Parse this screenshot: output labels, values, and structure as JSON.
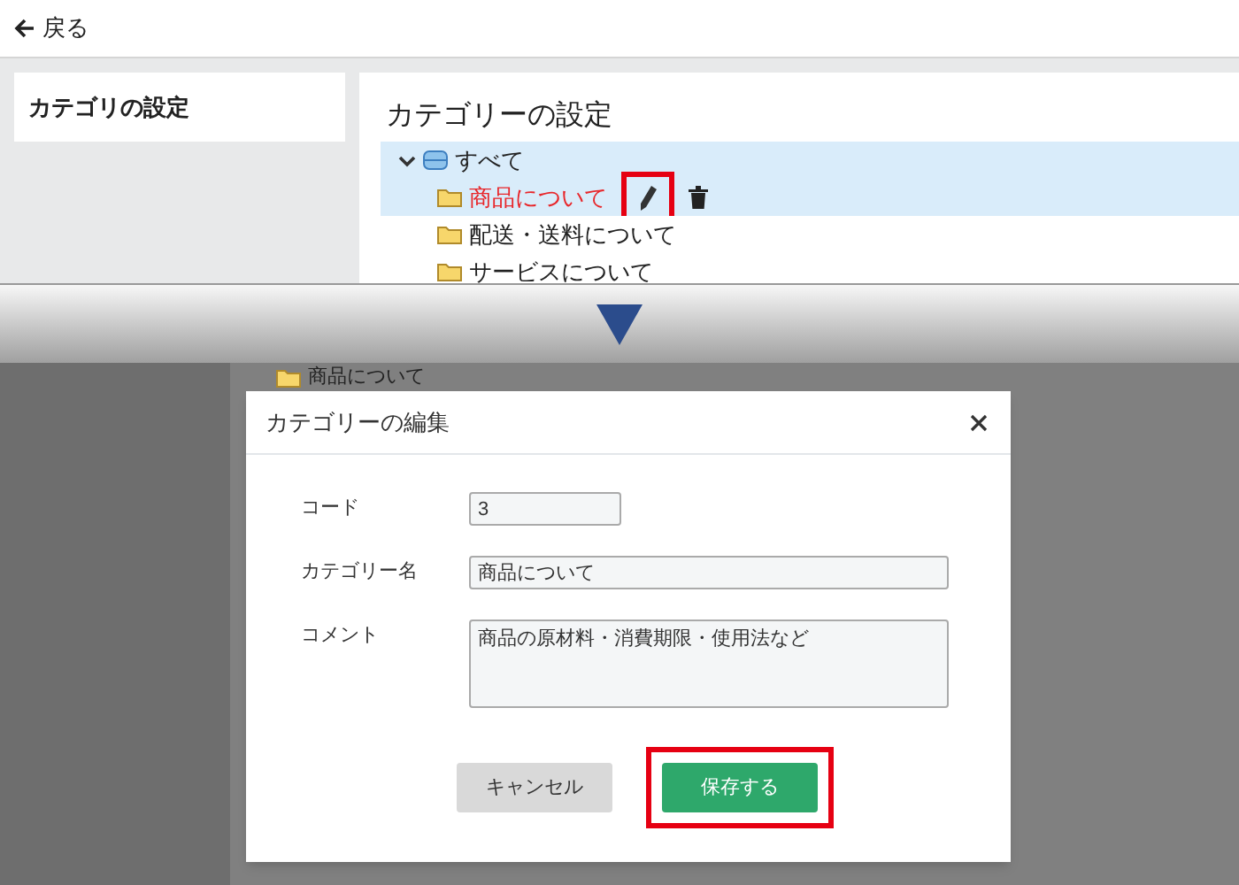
{
  "back_link": "戻る",
  "sidebar": {
    "title": "カテゴリの設定"
  },
  "main": {
    "title": "カテゴリーの設定",
    "tree": [
      {
        "label": "すべて",
        "kind": "root",
        "expanded": true,
        "selected": true,
        "children": [
          {
            "label": "商品について",
            "kind": "folder",
            "selected": true,
            "edit_callout": true
          },
          {
            "label": "配送・送料について",
            "kind": "folder",
            "selected": false
          },
          {
            "label": "サービスについて",
            "kind": "folder",
            "selected": false
          }
        ]
      }
    ]
  },
  "background_item": "商品について",
  "dialog": {
    "title": "カテゴリーの編集",
    "fields": [
      {
        "label": "コード",
        "value": "3",
        "kind": "short"
      },
      {
        "label": "カテゴリー名",
        "value": "商品について",
        "kind": "text"
      },
      {
        "label": "コメント",
        "value": "商品の原材料・消費期限・使用法など",
        "kind": "textarea"
      }
    ],
    "buttons": [
      {
        "label": "キャンセル",
        "kind": "secondary",
        "callout": false
      },
      {
        "label": "保存する",
        "kind": "primary",
        "callout": true
      }
    ]
  }
}
